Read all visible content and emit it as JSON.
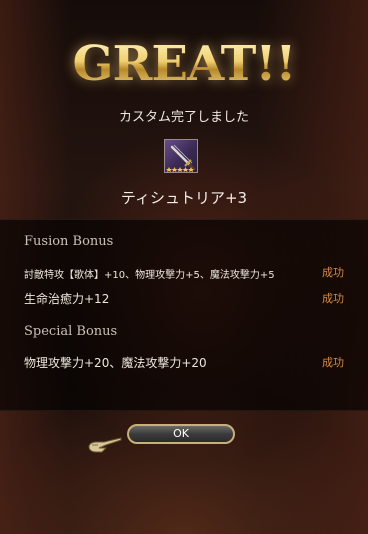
{
  "result": {
    "title": "GREAT!!",
    "message": "カスタム完了しました"
  },
  "item": {
    "name": "ティシュトリア+3",
    "icon": "sword-icon",
    "rarity_stars": 5
  },
  "fusion_bonus": {
    "heading": "Fusion Bonus",
    "rows": [
      {
        "text": "討敵特攻【歌体】+10、物理攻撃力+5、魔法攻撃力+5",
        "status": "成功"
      },
      {
        "text": "生命治癒力+12",
        "status": "成功"
      }
    ]
  },
  "special_bonus": {
    "heading": "Special Bonus",
    "rows": [
      {
        "text": "物理攻撃力+20、魔法攻撃力+20",
        "status": "成功"
      }
    ]
  },
  "ok_button": {
    "label": "OK"
  },
  "cursor": {
    "icon": "pointer-hand-icon"
  },
  "colors": {
    "title_gold": "#f0d070",
    "status_orange": "#d88a40",
    "button_border": "#c9b07a"
  }
}
